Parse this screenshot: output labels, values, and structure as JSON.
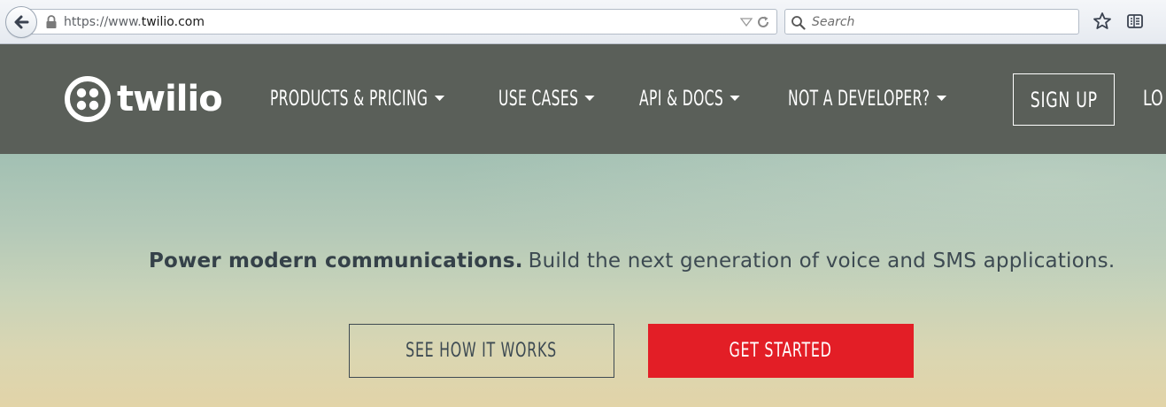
{
  "browser": {
    "url_prefix": "https://www.",
    "url_host": "twilio.com",
    "search_placeholder": "Search",
    "icons": [
      "back-arrow-icon",
      "lock-icon",
      "dropdown-icon",
      "reload-icon",
      "search-icon",
      "star-icon",
      "reader-icon"
    ]
  },
  "header": {
    "logo_text": "twilio",
    "nav": [
      {
        "label": "PRODUCTS & PRICING"
      },
      {
        "label": "USE CASES"
      },
      {
        "label": "API & DOCS"
      },
      {
        "label": "NOT A DEVELOPER?"
      }
    ],
    "signup_label": "SIGN UP",
    "login_label": "LO"
  },
  "hero": {
    "tagline_bold": "Power modern communications.",
    "tagline_rest": "Build the next generation of voice and SMS applications.",
    "see_label": "SEE HOW IT WORKS",
    "get_label": "GET STARTED"
  },
  "colors": {
    "header_bg": "#5a5f59",
    "accent_red": "#e31e26"
  }
}
